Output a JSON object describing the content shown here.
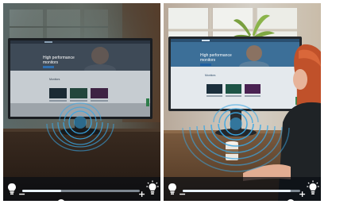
{
  "panels": [
    {
      "id": "left",
      "website": {
        "headline_line1": "High performance",
        "headline_line2": "monitors",
        "section_title": "Monitors"
      },
      "brightness_slider": {
        "value": 0.33,
        "minus": "−",
        "plus": "+"
      }
    },
    {
      "id": "right",
      "website": {
        "headline_line1": "High performance",
        "headline_line2": "monitors",
        "section_title": "Monitors"
      },
      "brightness_slider": {
        "value": 0.92,
        "minus": "−",
        "plus": "+"
      }
    }
  ],
  "icons": [
    "light-bulb-dim-icon",
    "light-bulb-bright-icon",
    "minus-icon",
    "plus-icon",
    "light-sensor-waves-icon"
  ],
  "colors": {
    "wave": "#3aa7e4",
    "slider_fill": "#e8f2fb",
    "slider_track": "#7d8791"
  }
}
